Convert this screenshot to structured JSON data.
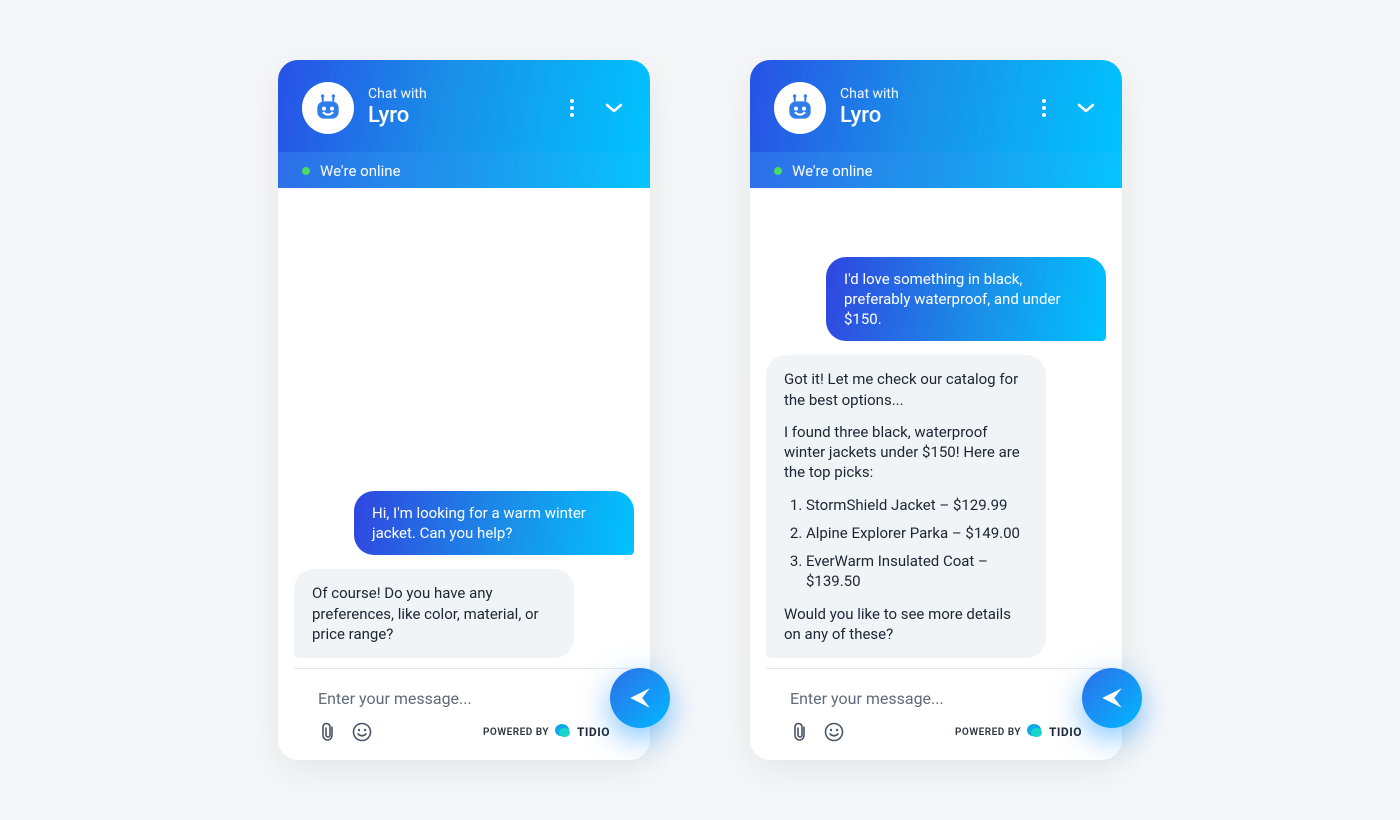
{
  "header": {
    "chat_with_label": "Chat with",
    "bot_name": "Lyro",
    "status_text": "We're online"
  },
  "input": {
    "placeholder": "Enter your message...",
    "powered_by_label": "POWERED BY",
    "brand": "TIDIO"
  },
  "widgets": [
    {
      "messages": [
        {
          "role": "user",
          "text": "Hi, I'm looking for a warm winter jacket. Can you help?"
        },
        {
          "role": "bot",
          "text": "Of course! Do you have any preferences, like color, material, or price range?"
        }
      ]
    },
    {
      "messages": [
        {
          "role": "user",
          "text": "I'd love something in black, preferably waterproof, and under $150."
        },
        {
          "role": "bot",
          "paragraphs": [
            "Got it! Let me check our catalog for the best options...",
            "I found three black, waterproof winter jackets under $150! Here are the top picks:"
          ],
          "list": [
            "StormShield Jacket – $129.99",
            "Alpine Explorer Parka – $149.00",
            "EverWarm Insulated Coat – $139.50"
          ],
          "closing": "Would you like to see more details on any of these?"
        }
      ]
    }
  ]
}
